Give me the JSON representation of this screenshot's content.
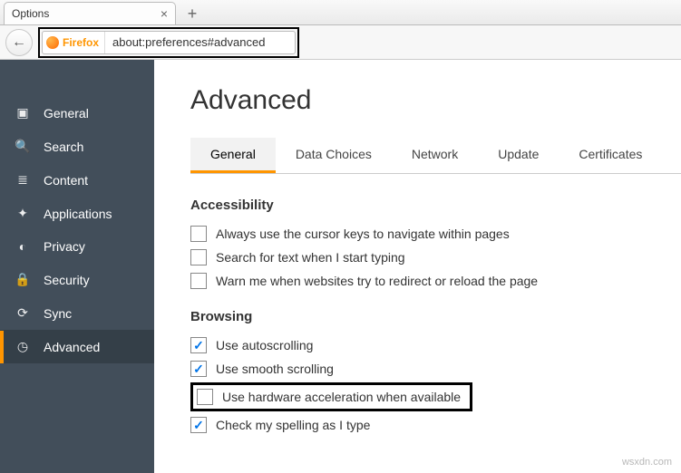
{
  "tab": {
    "title": "Options"
  },
  "url": {
    "badge": "Firefox",
    "address": "about:preferences#advanced"
  },
  "sidebar": {
    "items": [
      {
        "label": "General"
      },
      {
        "label": "Search"
      },
      {
        "label": "Content"
      },
      {
        "label": "Applications"
      },
      {
        "label": "Privacy"
      },
      {
        "label": "Security"
      },
      {
        "label": "Sync"
      },
      {
        "label": "Advanced"
      }
    ]
  },
  "page": {
    "title": "Advanced",
    "tabs": [
      "General",
      "Data Choices",
      "Network",
      "Update",
      "Certificates"
    ],
    "accessibility": {
      "heading": "Accessibility",
      "opts": [
        "Always use the cursor keys to navigate within pages",
        "Search for text when I start typing",
        "Warn me when websites try to redirect or reload the page"
      ]
    },
    "browsing": {
      "heading": "Browsing",
      "opts": [
        "Use autoscrolling",
        "Use smooth scrolling",
        "Use hardware acceleration when available",
        "Check my spelling as I type"
      ]
    }
  },
  "watermark": "wsxdn.com"
}
